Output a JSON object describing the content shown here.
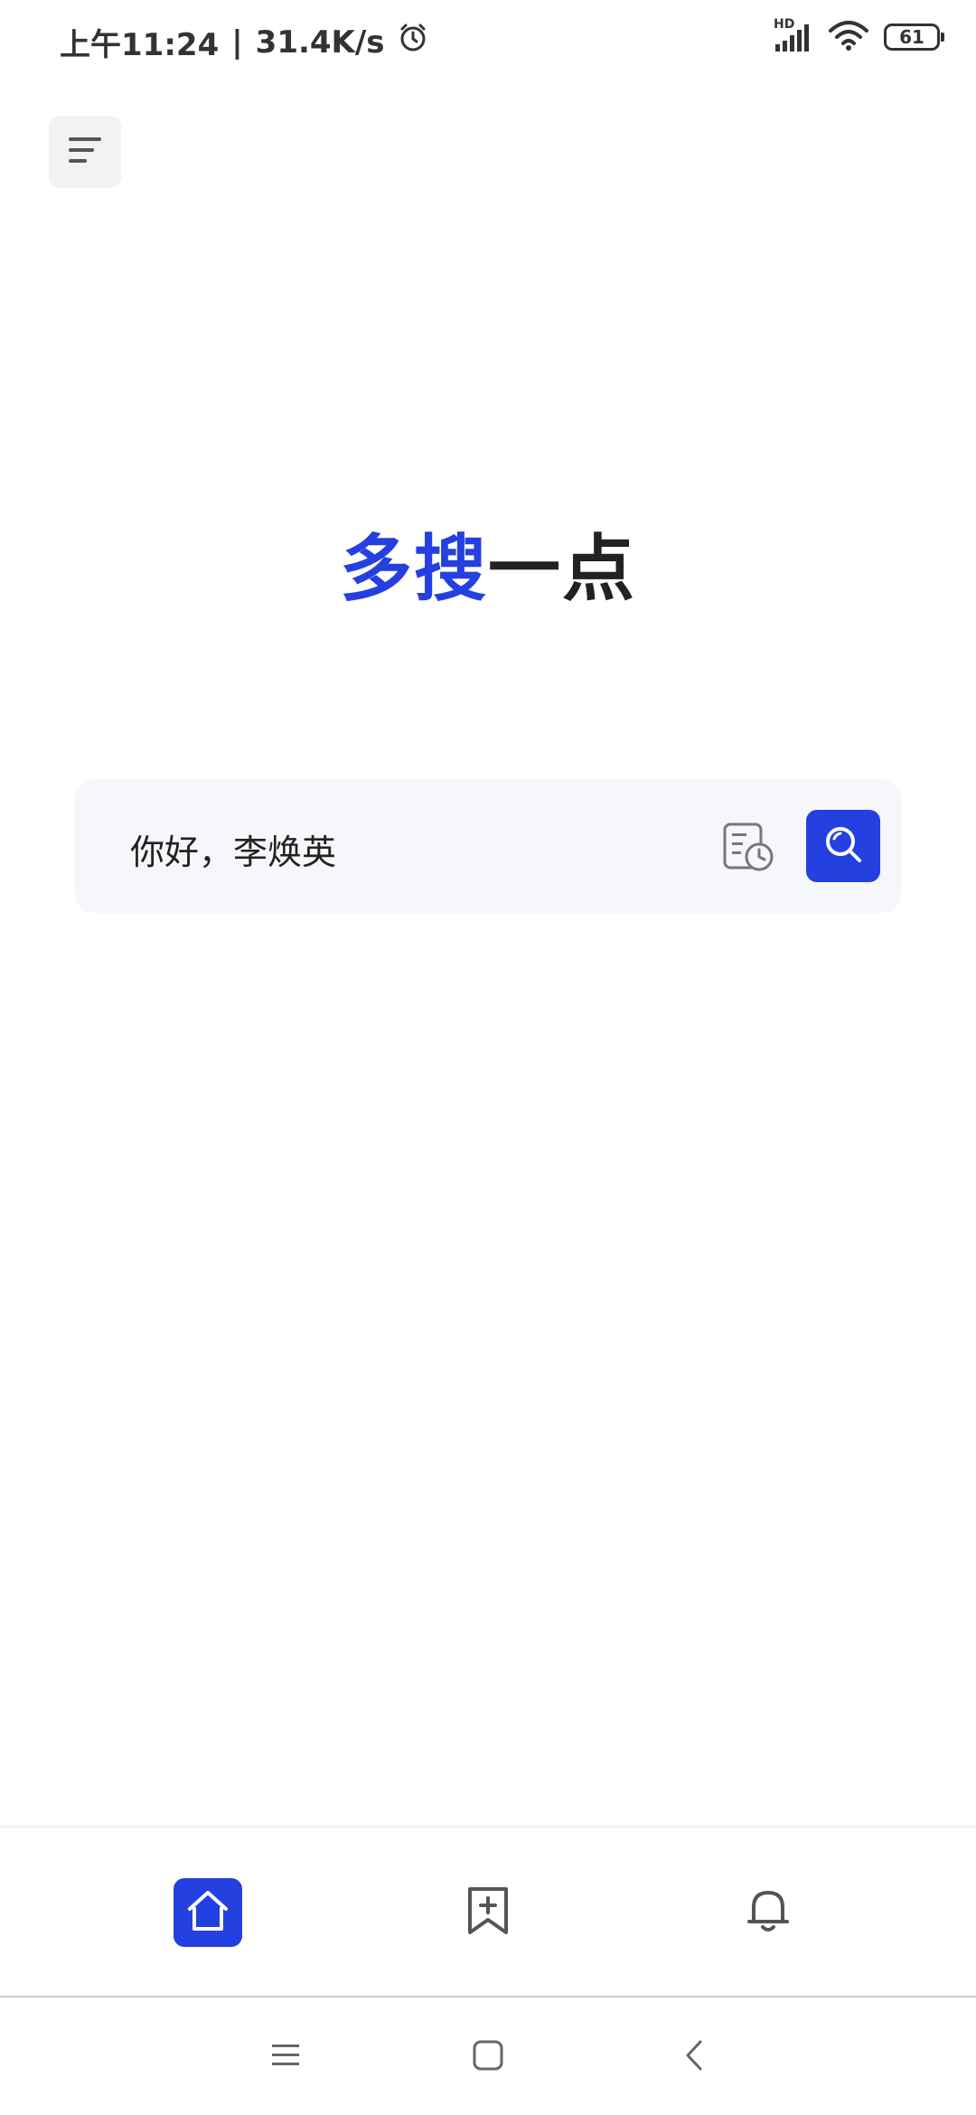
{
  "status_bar": {
    "time": "上午11:24",
    "separator": "|",
    "network_speed": "31.4K/s",
    "signal_label": "HD",
    "battery_level": "61"
  },
  "header": {
    "menu_icon": "menu-icon"
  },
  "logo": {
    "part_blue": "多搜",
    "part_dark": "一点",
    "accent_color": "#2540e0"
  },
  "search": {
    "value": "你好，李焕英",
    "history_icon": "history-icon",
    "search_icon": "search-icon"
  },
  "tab_bar": {
    "items": [
      {
        "icon": "home-icon",
        "active": true
      },
      {
        "icon": "bookmark-add-icon",
        "active": false
      },
      {
        "icon": "bell-icon",
        "active": false
      }
    ]
  },
  "system_nav": {
    "items": [
      "menu-icon",
      "square-home-icon",
      "back-icon"
    ]
  }
}
